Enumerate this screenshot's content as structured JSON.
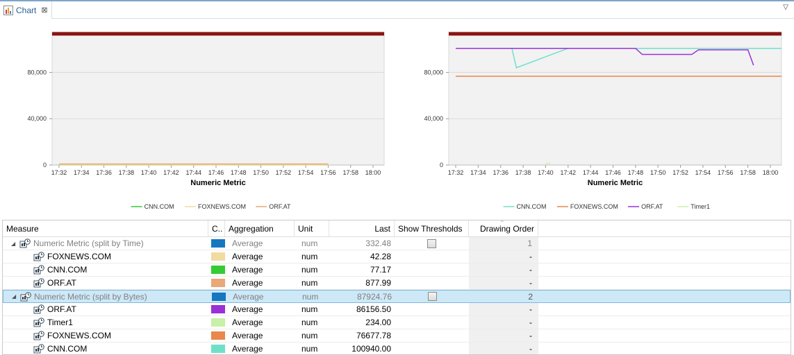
{
  "tab": {
    "title": "Chart",
    "close": "⊠",
    "view_menu": "▽"
  },
  "charts": [
    {
      "xlabel": "Numeric Metric",
      "y_ticks": [
        "80,000",
        "40,000",
        "0"
      ],
      "x_ticks": [
        "17:32",
        "17:34",
        "17:36",
        "17:38",
        "17:40",
        "17:42",
        "17:44",
        "17:46",
        "17:48",
        "17:50",
        "17:52",
        "17:54",
        "17:56",
        "17:58",
        "18:00"
      ],
      "legend": [
        {
          "name": "CNN.COM",
          "color": "#33cc33"
        },
        {
          "name": "FOXNEWS.COM",
          "color": "#f0dca0"
        },
        {
          "name": "ORF.AT",
          "color": "#e8a878"
        }
      ]
    },
    {
      "xlabel": "Numeric Metric",
      "y_ticks": [
        "80,000",
        "40,000",
        "0"
      ],
      "x_ticks": [
        "17:32",
        "17:34",
        "17:36",
        "17:38",
        "17:40",
        "17:42",
        "17:44",
        "17:46",
        "17:48",
        "17:50",
        "17:52",
        "17:54",
        "17:56",
        "17:58",
        "18:00"
      ],
      "legend": [
        {
          "name": "CNN.COM",
          "color": "#6fe0c8"
        },
        {
          "name": "FOXNEWS.COM",
          "color": "#e8884a"
        },
        {
          "name": "ORF.AT",
          "color": "#9b2fd8"
        },
        {
          "name": "Timer1",
          "color": "#c8f0a8"
        }
      ]
    }
  ],
  "chart_data": [
    {
      "type": "line",
      "xlabel": "Numeric Metric",
      "x": [
        "17:32",
        "17:34",
        "17:36",
        "17:38",
        "17:40",
        "17:42",
        "17:44",
        "17:46",
        "17:48",
        "17:50",
        "17:52",
        "17:54",
        "17:56",
        "17:58",
        "18:00"
      ],
      "ylim": [
        0,
        115000
      ],
      "threshold": 113000,
      "series": [
        {
          "name": "CNN.COM",
          "color": "#33cc33",
          "values": [
            60,
            70,
            80,
            60,
            60,
            90,
            80,
            160,
            70,
            60,
            80,
            120,
            60,
            null,
            null
          ]
        },
        {
          "name": "FOXNEWS.COM",
          "color": "#f0dca0",
          "values": [
            42,
            42,
            42,
            42,
            42,
            42,
            42,
            42,
            42,
            42,
            42,
            42,
            42,
            null,
            null
          ]
        },
        {
          "name": "ORF.AT",
          "color": "#e8a878",
          "values": [
            877,
            877,
            877,
            877,
            877,
            877,
            877,
            877,
            877,
            877,
            877,
            877,
            877,
            null,
            null
          ]
        }
      ]
    },
    {
      "type": "line",
      "xlabel": "Numeric Metric",
      "x": [
        "17:32",
        "17:34",
        "17:36",
        "17:38",
        "17:40",
        "17:42",
        "17:44",
        "17:46",
        "17:48",
        "17:50",
        "17:52",
        "17:54",
        "17:56",
        "17:58",
        "18:00"
      ],
      "ylim": [
        0,
        115000
      ],
      "threshold": 113000,
      "series": [
        {
          "name": "CNN.COM",
          "color": "#6fe0c8",
          "x": [
            0,
            5,
            5.4,
            10,
            26,
            29
          ],
          "values": [
            100800,
            100800,
            84000,
            100800,
            100800,
            100800
          ]
        },
        {
          "name": "FOXNEWS.COM",
          "color": "#e8884a",
          "x": [
            0,
            29
          ],
          "values": [
            76700,
            76700
          ]
        },
        {
          "name": "ORF.AT",
          "color": "#9b2fd8",
          "x": [
            0,
            16,
            16.6,
            21,
            21.6,
            24,
            24.3,
            26,
            26.5
          ],
          "values": [
            100800,
            100800,
            95500,
            95500,
            99500,
            99500,
            99500,
            99500,
            86200
          ]
        },
        {
          "name": "Timer1",
          "color": "#c8f0a8",
          "x": [
            8,
            8.4
          ],
          "values": [
            1500,
            1500
          ]
        }
      ]
    }
  ],
  "table": {
    "headers": {
      "measure": "Measure",
      "color": "C..",
      "aggregation": "Aggregation",
      "unit": "Unit",
      "last": "Last",
      "thresholds": "Show Thresholds",
      "order": "Drawing Order"
    },
    "rows": [
      {
        "level": 0,
        "measure": "Numeric Metric (split by Time)",
        "color": "#1477c0",
        "aggregation": "Average",
        "unit": "num",
        "last": "332.48",
        "threshold": true,
        "order": "1",
        "selected": false
      },
      {
        "level": 1,
        "measure": "FOXNEWS.COM",
        "color": "#f0dca0",
        "aggregation": "Average",
        "unit": "num",
        "last": "42.28",
        "threshold": false,
        "order": "-",
        "selected": false
      },
      {
        "level": 1,
        "measure": "CNN.COM",
        "color": "#33cc33",
        "aggregation": "Average",
        "unit": "num",
        "last": "77.17",
        "threshold": false,
        "order": "-",
        "selected": false
      },
      {
        "level": 1,
        "measure": "ORF.AT",
        "color": "#e8a878",
        "aggregation": "Average",
        "unit": "num",
        "last": "877.99",
        "threshold": false,
        "order": "-",
        "selected": false
      },
      {
        "level": 0,
        "measure": "Numeric Metric (split by Bytes)",
        "color": "#1477c0",
        "aggregation": "Average",
        "unit": "num",
        "last": "87924.76",
        "threshold": true,
        "order": "2",
        "selected": true
      },
      {
        "level": 1,
        "measure": "ORF.AT",
        "color": "#9b2fd8",
        "aggregation": "Average",
        "unit": "num",
        "last": "86156.50",
        "threshold": false,
        "order": "-",
        "selected": false
      },
      {
        "level": 1,
        "measure": "Timer1",
        "color": "#c8f0a8",
        "aggregation": "Average",
        "unit": "num",
        "last": "234.00",
        "threshold": false,
        "order": "-",
        "selected": false
      },
      {
        "level": 1,
        "measure": "FOXNEWS.COM",
        "color": "#e8884a",
        "aggregation": "Average",
        "unit": "num",
        "last": "76677.78",
        "threshold": false,
        "order": "-",
        "selected": false
      },
      {
        "level": 1,
        "measure": "CNN.COM",
        "color": "#6fe0c8",
        "aggregation": "Average",
        "unit": "num",
        "last": "100940.00",
        "threshold": false,
        "order": "-",
        "selected": false
      }
    ]
  }
}
